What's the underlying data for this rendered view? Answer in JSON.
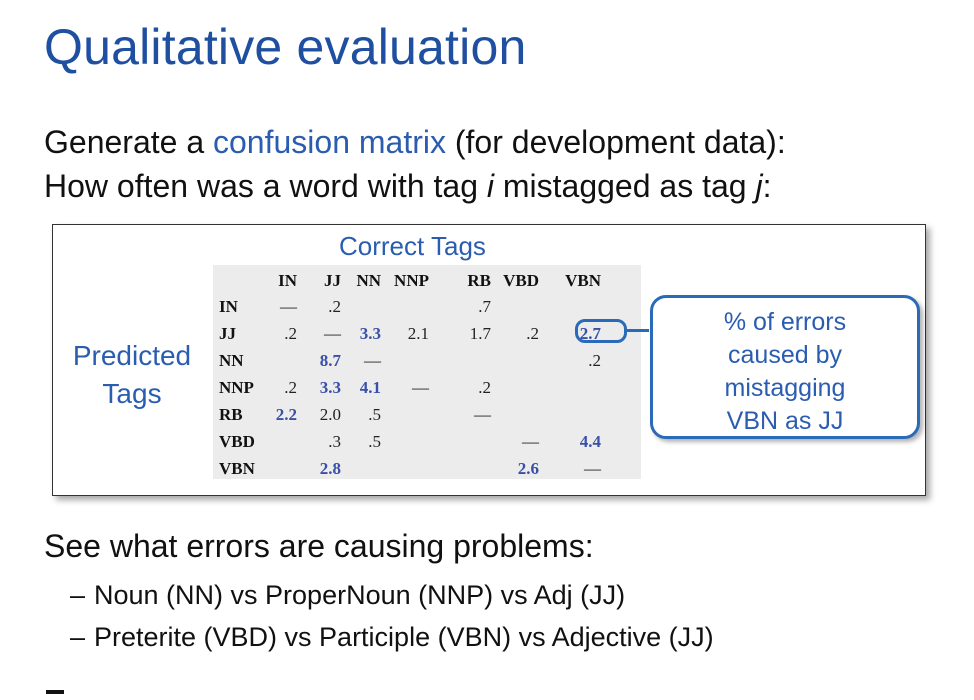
{
  "title": "Qualitative evaluation",
  "intro": {
    "line1_prefix": "Generate a ",
    "line1_highlight": "confusion matrix",
    "line1_suffix": " (for development data):",
    "line2_prefix": "How often was a word with tag ",
    "line2_var_i": "i",
    "line2_middle": " mistagged as tag ",
    "line2_var_j": "j",
    "line2_suffix": ":"
  },
  "figure": {
    "correct_tags_label": "Correct Tags",
    "predicted_tags_label_line1": "Predicted",
    "predicted_tags_label_line2": "Tags",
    "column_headers": [
      "IN",
      "JJ",
      "NN",
      "NNP",
      "RB",
      "VBD",
      "VBN"
    ],
    "row_headers": [
      "IN",
      "JJ",
      "NN",
      "NNP",
      "RB",
      "VBD",
      "VBN"
    ],
    "rows": [
      [
        "—",
        ".2",
        "",
        "",
        ".7",
        "",
        ""
      ],
      [
        ".2",
        "—",
        "3.3",
        "2.1",
        "1.7",
        ".2",
        "2.7"
      ],
      [
        "",
        "8.7",
        "—",
        "",
        "",
        "",
        ".2"
      ],
      [
        ".2",
        "3.3",
        "4.1",
        "—",
        ".2",
        "",
        ""
      ],
      [
        "2.2",
        "2.0",
        ".5",
        "",
        "—",
        "",
        ""
      ],
      [
        "",
        ".3",
        ".5",
        "",
        "",
        "—",
        "4.4"
      ],
      [
        "",
        "2.8",
        "",
        "",
        "",
        "2.6",
        "—"
      ]
    ],
    "callout_line1": "% of errors",
    "callout_line2": "caused by",
    "callout_line3": "mistagging",
    "callout_line4": "VBN as JJ",
    "accent_color": "#2a5db0"
  },
  "see_what": "See what errors are causing problems:",
  "bullets": [
    "Noun (NN) vs ProperNoun (NNP) vs Adj (JJ)",
    "Preterite (VBD) vs Participle (VBN) vs Adjective (JJ)"
  ],
  "bullet_marker": "–"
}
